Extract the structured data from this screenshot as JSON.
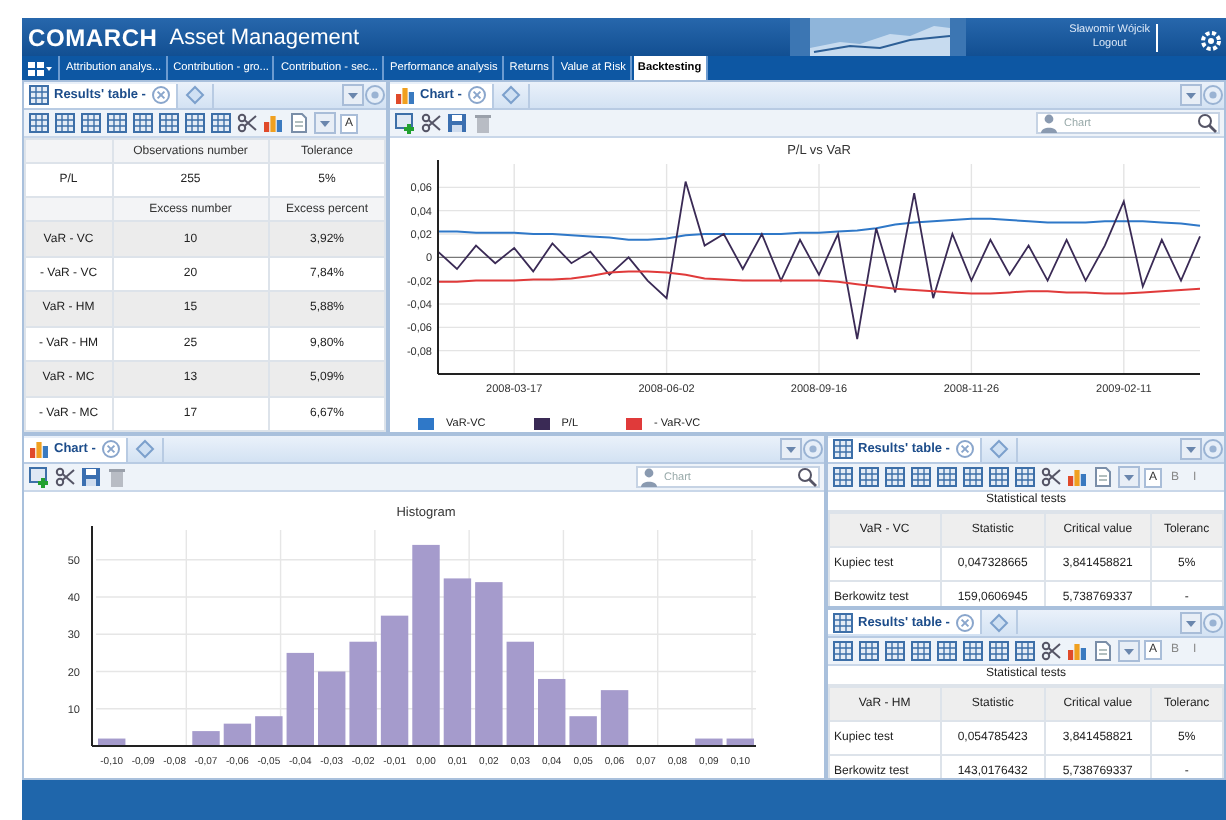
{
  "header": {
    "logo": "COMARCH",
    "product": "Asset Management",
    "user": "Sławomir Wójcik",
    "logout": "Logout"
  },
  "tabs": [
    {
      "label": "Attribution analys...",
      "selected": false
    },
    {
      "label": "Contribution - gro...",
      "selected": false
    },
    {
      "label": "Contribution - sec...",
      "selected": false
    },
    {
      "label": "Performance analysis",
      "selected": false
    },
    {
      "label": "Returns",
      "selected": false
    },
    {
      "label": "Value at Risk",
      "selected": false
    },
    {
      "label": "Backtesting",
      "selected": true
    }
  ],
  "results_table": {
    "title": "Results' table -",
    "toolbar_text": [
      "A"
    ],
    "rows": [
      {
        "kind": "header",
        "cells": [
          "Observations number",
          "Tolerance"
        ]
      },
      {
        "kind": "data",
        "cells": [
          "P/L",
          "255",
          "5%"
        ]
      },
      {
        "kind": "header",
        "cells": [
          "Excess number",
          "Excess percent"
        ]
      },
      {
        "kind": "data",
        "cells": [
          "VaR - VC",
          "10",
          "3,92%"
        ]
      },
      {
        "kind": "data",
        "cells": [
          "- VaR - VC",
          "20",
          "7,84%"
        ]
      },
      {
        "kind": "data",
        "cells": [
          "VaR - HM",
          "15",
          "5,88%"
        ]
      },
      {
        "kind": "data",
        "cells": [
          "- VaR - HM",
          "25",
          "9,80%"
        ]
      },
      {
        "kind": "data",
        "cells": [
          "VaR - MC",
          "13",
          "5,09%"
        ]
      },
      {
        "kind": "data",
        "cells": [
          "- VaR - MC",
          "17",
          "6,67%"
        ]
      }
    ]
  },
  "line_chart_panel": {
    "title": "Chart -",
    "search": {
      "placeholder": "Chart"
    },
    "chart_data": {
      "type": "line",
      "title": "P/L vs VaR",
      "categories": [
        null,
        null,
        null,
        null,
        "2008-03-17",
        null,
        null,
        null,
        null,
        null,
        null,
        null,
        "2008-06-02",
        null,
        null,
        null,
        null,
        null,
        null,
        null,
        "2008-09-16",
        null,
        null,
        null,
        null,
        null,
        null,
        null,
        "2008-11-26",
        null,
        null,
        null,
        null,
        null,
        null,
        null,
        "2009-02-11",
        null,
        null,
        null,
        null
      ],
      "series": [
        {
          "name": "VaR-VC",
          "color": "#2f78c8",
          "values": [
            0.022,
            0.022,
            0.021,
            0.021,
            0.021,
            0.02,
            0.02,
            0.019,
            0.018,
            0.017,
            0.015,
            0.015,
            0.016,
            0.019,
            0.02,
            0.02,
            0.02,
            0.02,
            0.02,
            0.021,
            0.021,
            0.022,
            0.023,
            0.025,
            0.028,
            0.03,
            0.031,
            0.032,
            0.033,
            0.033,
            0.032,
            0.031,
            0.03,
            0.03,
            0.03,
            0.031,
            0.031,
            0.031,
            0.03,
            0.029,
            0.027
          ]
        },
        {
          "name": "P/L",
          "color": "#3a2a55",
          "values": [
            0.005,
            -0.01,
            0.01,
            -0.005,
            0.008,
            -0.012,
            0.012,
            -0.005,
            0.005,
            -0.015,
            0.0,
            -0.02,
            -0.035,
            0.065,
            0.01,
            0.02,
            -0.01,
            0.02,
            -0.02,
            0.015,
            -0.015,
            0.02,
            -0.07,
            0.025,
            -0.03,
            0.055,
            -0.035,
            0.02,
            -0.02,
            0.015,
            -0.015,
            0.01,
            -0.02,
            0.015,
            -0.02,
            0.01,
            0.048,
            -0.025,
            0.015,
            -0.02,
            0.018
          ]
        },
        {
          "name": "- VaR-VC",
          "color": "#e03a3a",
          "values": [
            -0.021,
            -0.021,
            -0.02,
            -0.02,
            -0.02,
            -0.019,
            -0.019,
            -0.018,
            -0.016,
            -0.013,
            -0.012,
            -0.012,
            -0.013,
            -0.015,
            -0.018,
            -0.019,
            -0.02,
            -0.02,
            -0.02,
            -0.02,
            -0.02,
            -0.021,
            -0.023,
            -0.025,
            -0.027,
            -0.028,
            -0.029,
            -0.03,
            -0.031,
            -0.031,
            -0.03,
            -0.029,
            -0.029,
            -0.03,
            -0.03,
            -0.031,
            -0.031,
            -0.03,
            -0.029,
            -0.028,
            -0.027
          ]
        }
      ],
      "ylim": [
        -0.1,
        0.08
      ],
      "grid": true,
      "legend": "bottom",
      "yticks": [
        {
          "value": 0.06,
          "label": "0,06"
        },
        {
          "value": 0.04,
          "label": "0,04"
        },
        {
          "value": 0.02,
          "label": "0,02"
        },
        {
          "value": 0,
          "label": "0"
        },
        {
          "value": -0.02,
          "label": "-0,02"
        },
        {
          "value": -0.04,
          "label": "-0,04"
        },
        {
          "value": -0.06,
          "label": "-0,06"
        },
        {
          "value": -0.08,
          "label": "-0,08"
        }
      ]
    }
  },
  "histogram_panel": {
    "title": "Chart -",
    "search": {
      "placeholder": "Chart"
    },
    "chart_data": {
      "type": "bar",
      "title": "Histogram",
      "categories": [
        "-0,10",
        "-0,09",
        "-0,08",
        "-0,07",
        "-0,06",
        "-0,05",
        "-0,04",
        "-0,03",
        "-0,02",
        "-0,01",
        "0,00",
        "0,01",
        "0,02",
        "0,03",
        "0,04",
        "0,05",
        "0,06",
        "0,07",
        "0,08",
        "0,09",
        "0,10"
      ],
      "series": [
        {
          "color": "#a59bcc",
          "values": [
            2,
            0,
            0,
            4,
            6,
            8,
            25,
            20,
            28,
            35,
            54,
            45,
            44,
            28,
            18,
            8,
            15,
            0,
            0,
            2,
            2
          ]
        }
      ],
      "ylim": [
        0,
        58
      ],
      "yticks": [
        10,
        20,
        30,
        40,
        50
      ],
      "grid": true
    }
  },
  "stats_tables": [
    {
      "title": "Results' table -",
      "toolbar_text": [
        "A",
        "B",
        "I"
      ],
      "caption": "Statistical tests",
      "columns": [
        "VaR - VC",
        "Statistic",
        "Critical value",
        "Toleranc"
      ],
      "rows": [
        [
          "Kupiec test",
          "0,047328665",
          "3,841458821",
          "5%"
        ],
        [
          "Berkowitz test",
          "159,0606945",
          "5,738769337",
          "-"
        ]
      ]
    },
    {
      "title": "Results' table -",
      "toolbar_text": [
        "A",
        "B",
        "I"
      ],
      "caption": "Statistical tests",
      "columns": [
        "VaR - HM",
        "Statistic",
        "Critical value",
        "Toleranc"
      ],
      "rows": [
        [
          "Kupiec test",
          "0,054785423",
          "3,841458821",
          "5%"
        ],
        [
          "Berkowitz test",
          "143,0176432",
          "5,738769337",
          "-"
        ]
      ]
    }
  ]
}
